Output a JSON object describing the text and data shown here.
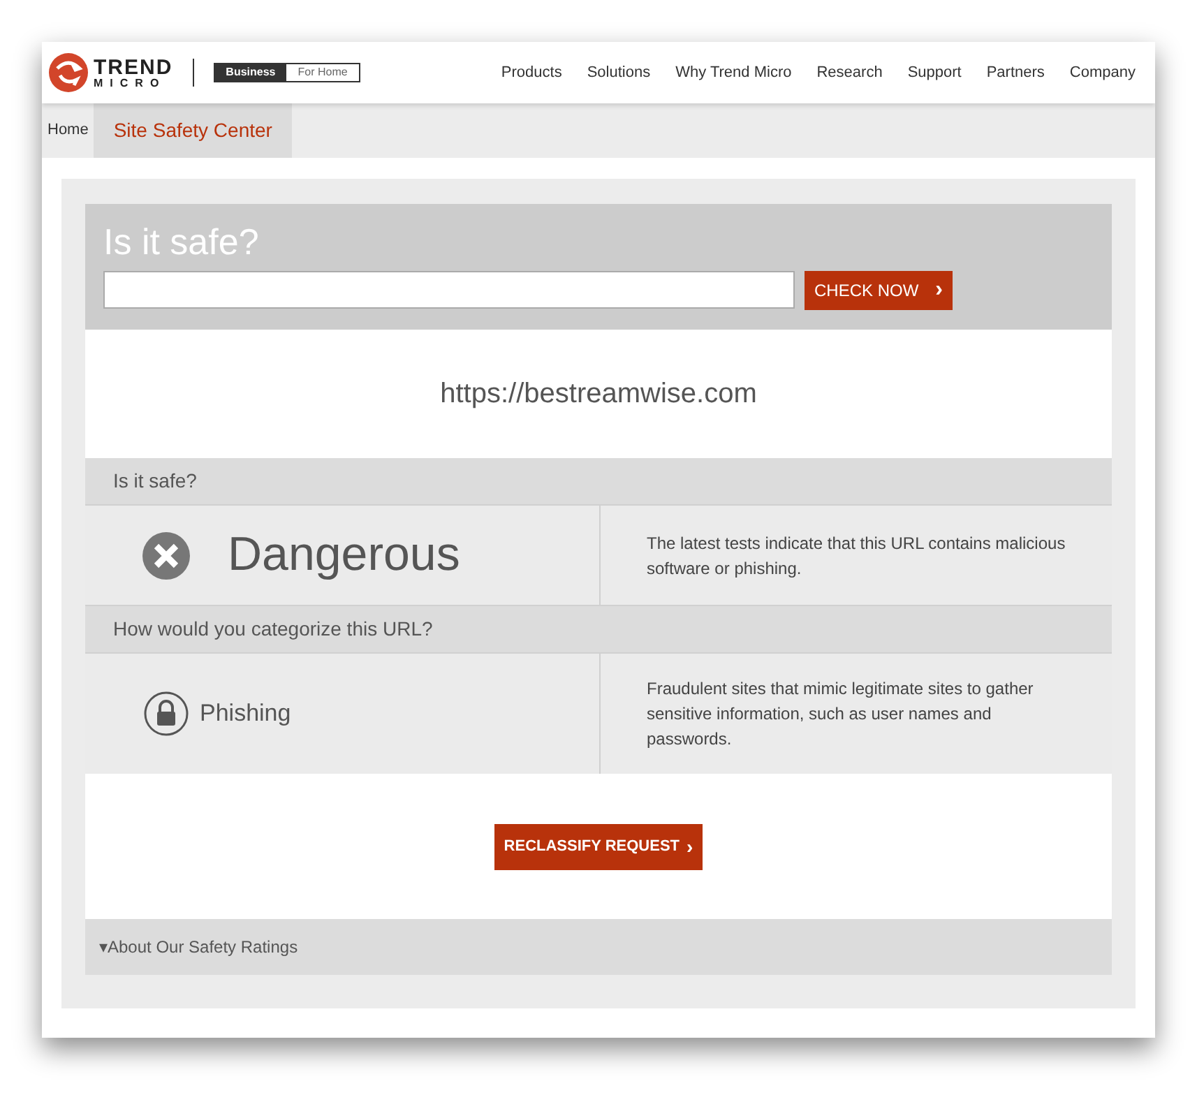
{
  "header": {
    "logo": {
      "line_1": "TREND",
      "line_2": "MICRO"
    },
    "segments": [
      {
        "label": "Business",
        "selected": true
      },
      {
        "label": "For Home",
        "selected": false
      }
    ],
    "nav": [
      "Products",
      "Solutions",
      "Why Trend Micro",
      "Research",
      "Support",
      "Partners",
      "Company"
    ]
  },
  "breadcrumb": [
    {
      "label": "Home",
      "selected": false
    },
    {
      "label": "Site Safety Center",
      "selected": true
    }
  ],
  "check": {
    "title": "Is it safe?",
    "button": "CHECK NOW",
    "button_icon": "›"
  },
  "url": "https://bestreamwise.com",
  "sections": [
    {
      "heading": "Is it safe?",
      "kind": "rating",
      "label": "Dangerous",
      "description": "The latest tests indicate that this URL contains malicious software or phishing."
    },
    {
      "heading": "How would you categorize this URL?",
      "kind": "category",
      "label": "Phishing",
      "description": "Fraudulent sites that mimic legitimate sites to gather sensitive information, such as user names and passwords."
    }
  ],
  "reclassify": {
    "label": "RECLASSIFY REQUEST",
    "icon": "›"
  },
  "about": {
    "icon": "▾",
    "label": "About Our Safety Ratings",
    "expanded": false
  }
}
